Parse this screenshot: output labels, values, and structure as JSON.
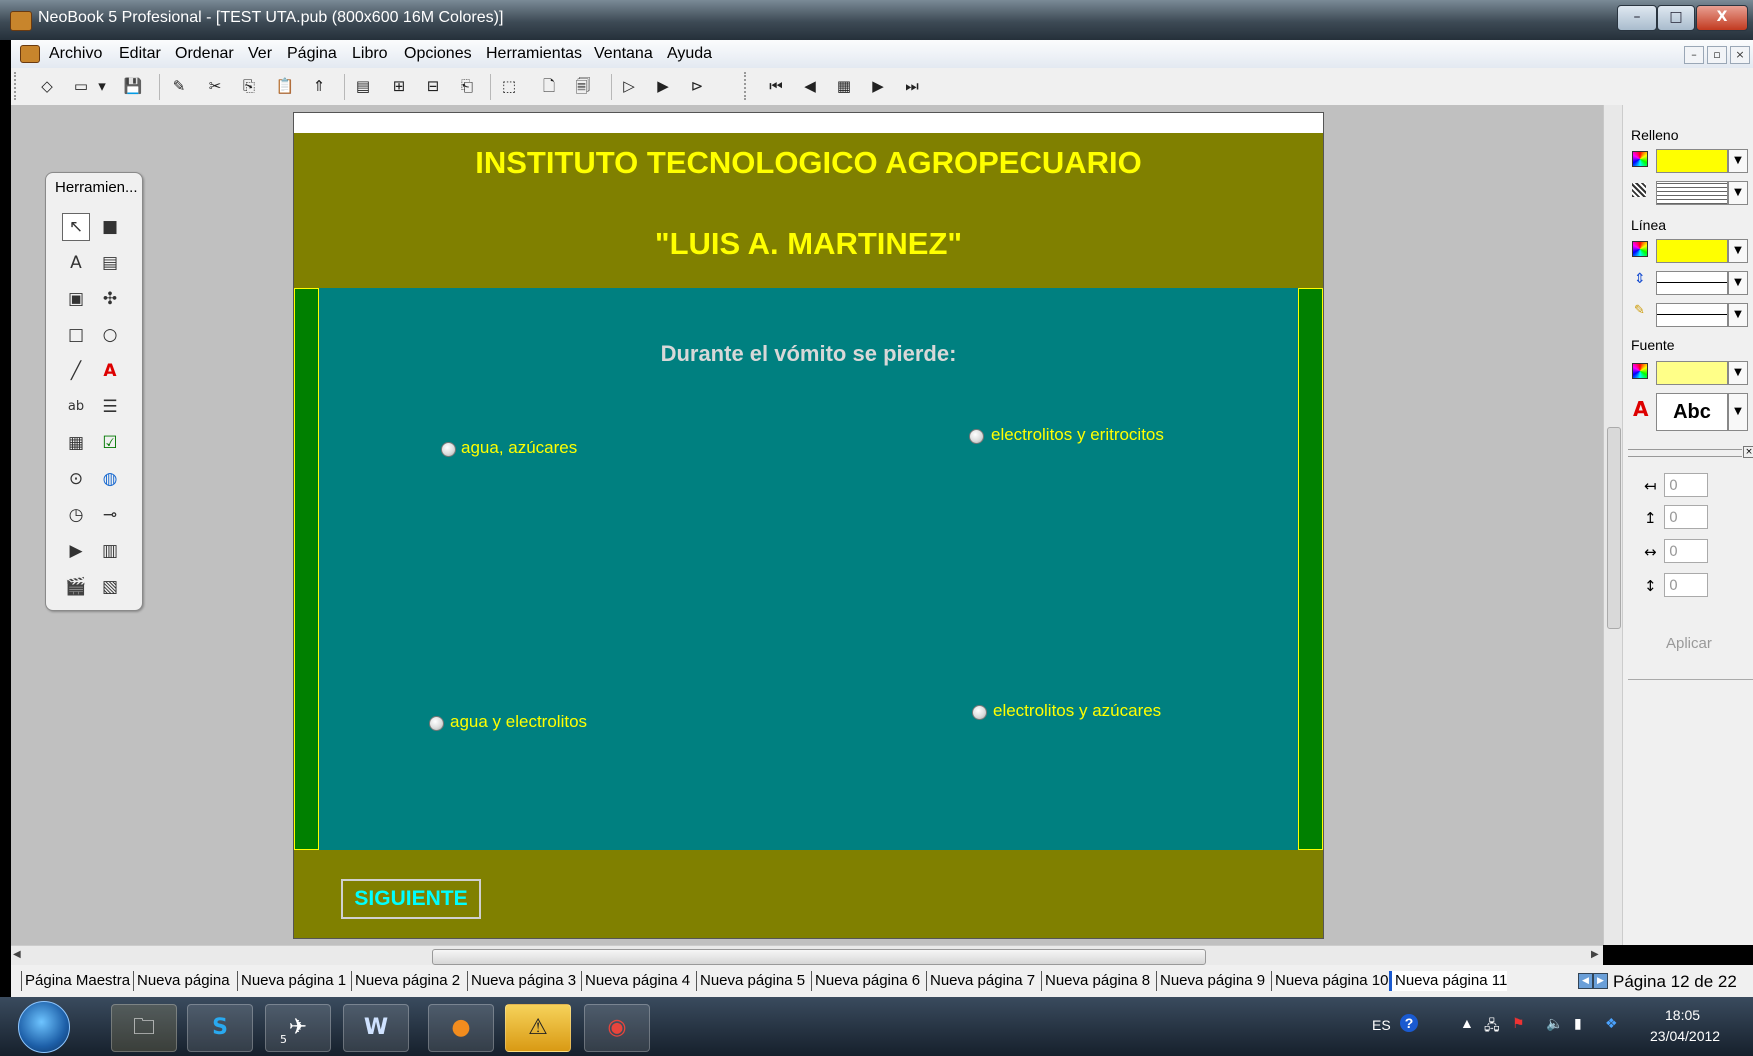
{
  "window": {
    "title": "NeoBook 5 Profesional - [TEST UTA.pub (800x600 16M Colores)]",
    "controls": {
      "minimize": "–",
      "maximize": "□",
      "close": "X"
    }
  },
  "menu": {
    "items": [
      "Archivo",
      "Editar",
      "Ordenar",
      "Ver",
      "Página",
      "Libro",
      "Opciones",
      "Herramientas",
      "Ventana",
      "Ayuda"
    ],
    "mdi_controls": [
      "–",
      "▫",
      "×"
    ]
  },
  "toolbar": {
    "icons": [
      "eraser-icon",
      "open-folder-icon",
      "save-icon",
      "pencil-icon",
      "cut-icon",
      "copy-icon",
      "paste-icon",
      "brush-icon",
      "align-icon",
      "group-icon",
      "ungroup-icon",
      "order-icon",
      "select-all-icon",
      "new-page-icon",
      "page-props-icon",
      "run-icon",
      "run-page-icon",
      "run-book-icon",
      "first-page-icon",
      "prev-page-icon",
      "page-list-icon",
      "next-page-icon",
      "last-page-icon"
    ],
    "glyphs": [
      "◇",
      "▭",
      "▾",
      "💾",
      "✎",
      "✂",
      "⎘",
      "📋",
      "⇑",
      "▤",
      "⊞",
      "⊟",
      "⎗",
      "⬚",
      "🗋",
      "🗐",
      "▷",
      "▶",
      "⊳",
      "⏮",
      "◀",
      "▦",
      "▶",
      "⏭"
    ]
  },
  "tools_palette": {
    "title": "Herramien...",
    "tools": [
      "pointer-tool",
      "rectangle-select-tool",
      "text-tool",
      "article-tool",
      "picture-tool",
      "puzzle-tool",
      "rectangle-tool",
      "ellipse-tool",
      "line-tool",
      "font-tool",
      "textentry-tool",
      "listbox-tool",
      "combobox-tool",
      "checkbox-tool",
      "radio-tool",
      "web-tool",
      "timer-tool",
      "slider-tool",
      "media-tool",
      "film-tool",
      "animation-tool",
      "panel-tool"
    ],
    "glyphs": [
      "↖",
      "■",
      "A",
      "▤",
      "▣",
      "✣",
      "□",
      "○",
      "╱",
      "A",
      "ab",
      "☰",
      "▦",
      "☑",
      "⊙",
      "◍",
      "◷",
      "⊸",
      "▶",
      "▥",
      "🎬",
      "▧"
    ]
  },
  "page": {
    "heading1": "INSTITUTO TECNOLOGICO AGROPECUARIO",
    "heading2": "\"LUIS A. MARTINEZ\"",
    "question": "Durante el vómito se pierde:",
    "options": [
      "agua, azúcares",
      "electrolitos y eritrocitos",
      "agua y electrolitos",
      "electrolitos y azúcares"
    ],
    "next_button": "SIGUIENTE"
  },
  "properties_panel": {
    "fill_label": "Relleno",
    "line_label": "Línea",
    "font_label": "Fuente",
    "font_sample": "Abc",
    "fill_color": "#ffff00",
    "line_color": "#ffff00",
    "font_color": "#ffff88",
    "position_values": [
      "0",
      "0",
      "0",
      "0"
    ],
    "apply_button": "Aplicar"
  },
  "tabs": {
    "items": [
      "Página Maestra",
      "Nueva página",
      "Nueva página 1",
      "Nueva página 2",
      "Nueva página 3",
      "Nueva página 4",
      "Nueva página 5",
      "Nueva página 6",
      "Nueva página 7",
      "Nueva página 8",
      "Nueva página 9",
      "Nueva página 10",
      "Nueva página 11"
    ],
    "active_index": 12,
    "page_info": "Página 12 de 22"
  },
  "taskbar": {
    "apps": [
      "explorer-icon",
      "skype-icon",
      "neobook-icon",
      "word-icon",
      "ahorro-icon",
      "warning-icon",
      "chrome-icon"
    ],
    "app_glyphs": [
      "🗀",
      "S",
      "✈",
      "W",
      "●",
      "⚠",
      "◉"
    ],
    "app_badge": "5",
    "language": "ES",
    "time": "18:05",
    "date": "23/04/2012"
  },
  "colors": {
    "page_background": "#808000",
    "content_background": "#008080",
    "side_bars": "#008000",
    "heading_text": "#ffff00",
    "next_button_text": "#00ffff"
  }
}
